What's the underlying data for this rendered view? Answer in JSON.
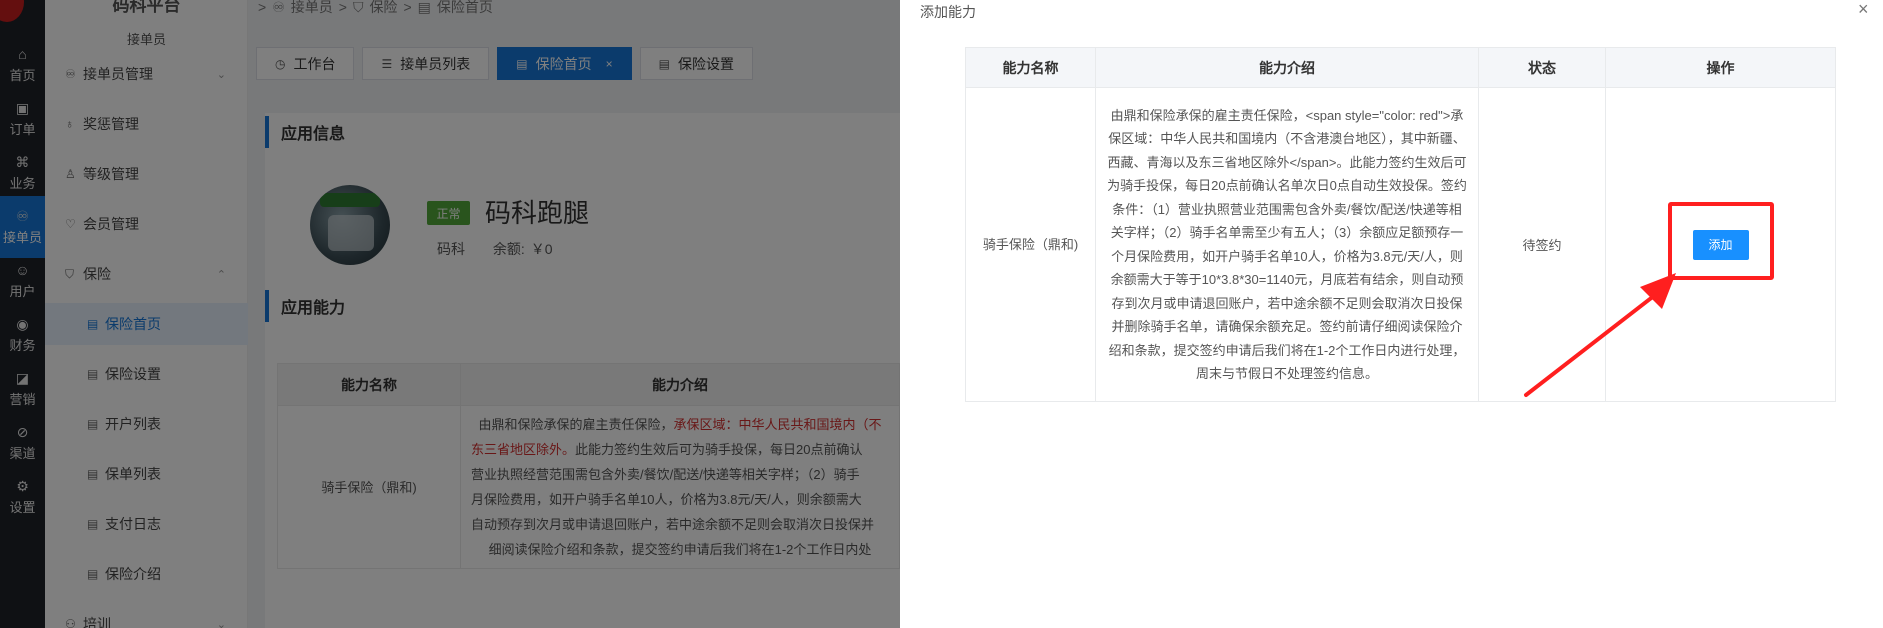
{
  "rail": {
    "items": [
      {
        "icon": "home-icon",
        "label": "首页"
      },
      {
        "icon": "order-icon",
        "label": "订单"
      },
      {
        "icon": "grid-icon",
        "label": "业务"
      },
      {
        "icon": "rider-icon",
        "label": "接单员"
      },
      {
        "icon": "user-icon",
        "label": "用户"
      },
      {
        "icon": "finance-icon",
        "label": "财务"
      },
      {
        "icon": "marketing-icon",
        "label": "营销"
      },
      {
        "icon": "channel-icon",
        "label": "渠道"
      },
      {
        "icon": "settings-icon",
        "label": "设置"
      }
    ]
  },
  "submenu": {
    "app_title": "码科平台",
    "section_title": "接单员",
    "items": [
      {
        "label": "接单员管理",
        "icon": "rider-icon"
      },
      {
        "label": "奖惩管理",
        "icon": "award-icon"
      },
      {
        "label": "等级管理",
        "icon": "level-icon"
      },
      {
        "label": "会员管理",
        "icon": "member-icon"
      },
      {
        "label": "保险",
        "icon": "shield-icon"
      },
      {
        "label": "保险首页",
        "icon": "doc-icon"
      },
      {
        "label": "保险设置",
        "icon": "doc-icon"
      },
      {
        "label": "开户列表",
        "icon": "doc-icon"
      },
      {
        "label": "保单列表",
        "icon": "doc-icon"
      },
      {
        "label": "支付日志",
        "icon": "doc-icon"
      },
      {
        "label": "保险介绍",
        "icon": "doc-icon"
      },
      {
        "label": "培训",
        "icon": "training-icon"
      }
    ]
  },
  "breadcrumb": {
    "sep": ">",
    "items": [
      "接单员",
      "保险",
      "保险首页"
    ]
  },
  "tabs": [
    {
      "label": "工作台"
    },
    {
      "label": "接单员列表"
    },
    {
      "label": "保险首页",
      "close": "×"
    },
    {
      "label": "保险设置"
    }
  ],
  "main": {
    "section_app_info": "应用信息",
    "status": "正常",
    "app_name": "码科跑腿",
    "owner": "码科",
    "balance_label": "余额:",
    "balance_value": "￥0",
    "section_capability": "应用能力",
    "table_headers": {
      "name": "能力名称",
      "desc": "能力介绍"
    },
    "row": {
      "name": "骑手保险（鼎和)",
      "desc_line1_plain": "由鼎和保险承保的雇主责任保险，",
      "desc_line1_red": "承保区域：中华人民共和国境内（不",
      "desc_line2_red": "东三省地区除外。",
      "desc_line2_plain": "此能力签约生效后可为骑手投保，每日20点前确认",
      "desc_line3": "营业执照经营范围需包含外卖/餐饮/配送/快递等相关字样；（2）骑手",
      "desc_line4": "月保险费用，如开户骑手名单10人，价格为3.8元/天/人，则余额需大",
      "desc_line5": "自动预存到次月或申请退回账户，若中途余额不足则会取消次日投保并",
      "desc_line6": "细阅读保险介绍和条款，提交签约申请后我们将在1-2个工作日内处"
    }
  },
  "drawer": {
    "title": "添加能力",
    "close": "×",
    "headers": {
      "name": "能力名称",
      "desc": "能力介绍",
      "status": "状态",
      "action": "操作"
    },
    "row": {
      "name": "骑手保险（鼎和)",
      "desc": "由鼎和保险承保的雇主责任保险，<span style=\"color: red\">承保区域：中华人民共和国境内（不含港澳台地区），其中新疆、西藏、青海以及东三省地区除外</span>。此能力签约生效后可为骑手投保，每日20点前确认名单次日0点自动生效投保。签约条件：（1）营业执照营业范围需包含外卖/餐饮/配送/快递等相关字样；（2）骑手名单需至少有五人；（3）余额应足额预存一个月保险费用，如开户骑手名单10人，价格为3.8元/天/人，则余额需大于等于10*3.8*30=1140元，月底若有结余，则自动预存到次月或申请退回账户，若中途余额不足则会取消次日投保并删除骑手名单，请确保余额充足。签约前请仔细阅读保险介绍和条款，提交签约申请后我们将在1-2个工作日内进行处理，周末与节假日不处理签约信息。",
      "status": "待签约",
      "action": "添加"
    }
  },
  "colors": {
    "accent": "#1677d8",
    "button": "#1890ff",
    "highlight": "#ff1f1f",
    "status_green": "#52a83a",
    "rail_bg": "#1f2229"
  }
}
